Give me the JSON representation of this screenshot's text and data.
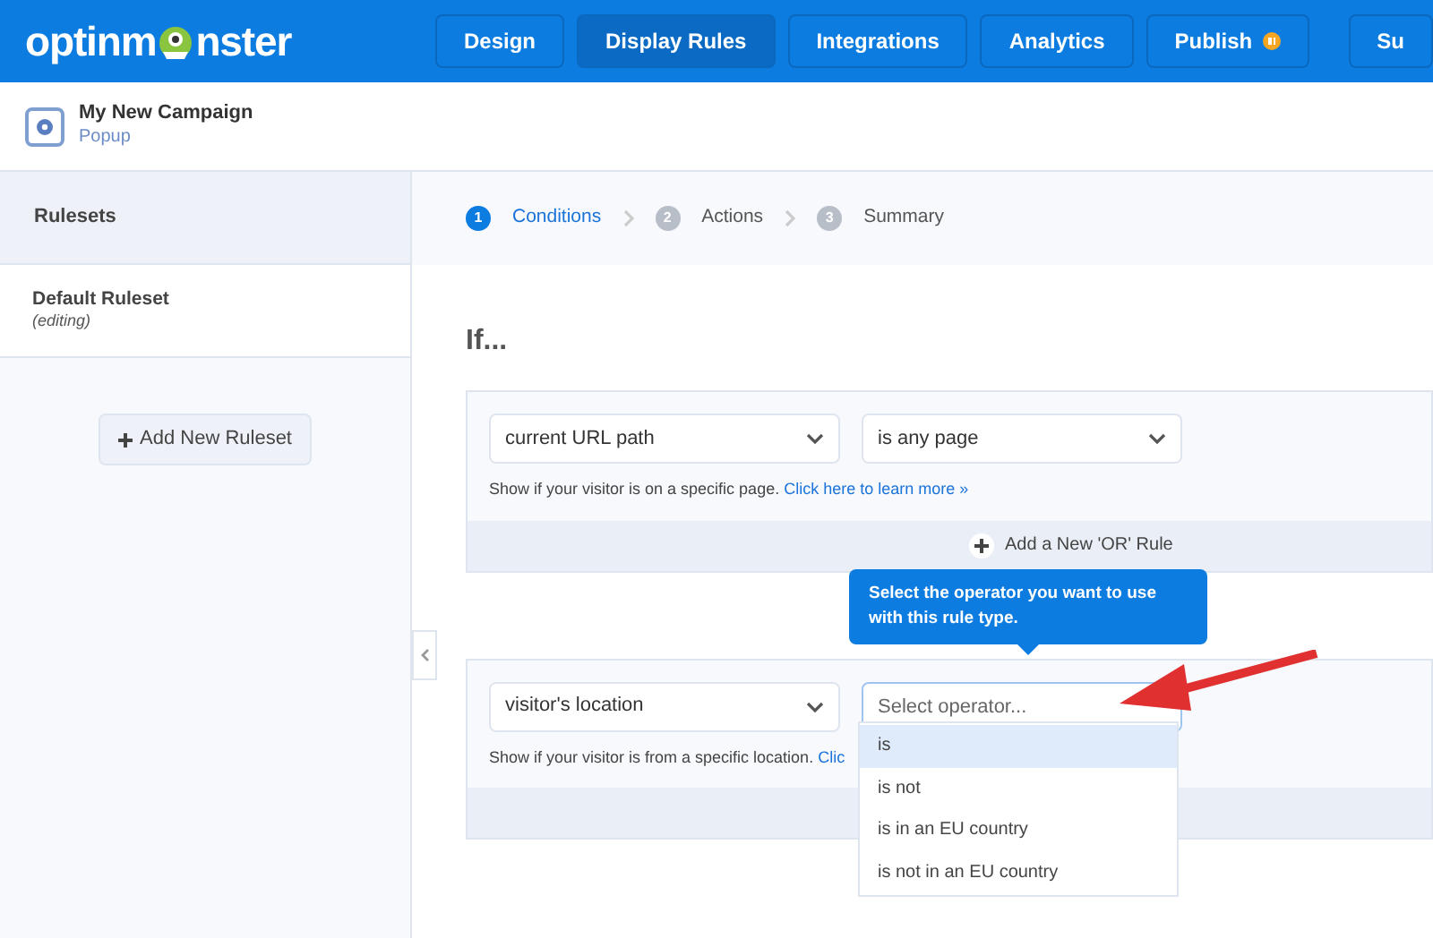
{
  "logo": {
    "before": "optinm",
    "after": "nster"
  },
  "nav": [
    {
      "label": "Design",
      "selected": false
    },
    {
      "label": "Display Rules",
      "selected": true
    },
    {
      "label": "Integrations",
      "selected": false
    },
    {
      "label": "Analytics",
      "selected": false
    },
    {
      "label": "Publish",
      "selected": false,
      "badge": true
    },
    {
      "label": "Su",
      "selected": false
    }
  ],
  "campaign": {
    "title": "My New Campaign",
    "type": "Popup"
  },
  "sidebar": {
    "title": "Rulesets",
    "rulesets": [
      {
        "name": "Default Ruleset",
        "status": "(editing)"
      }
    ],
    "add_button": "Add New Ruleset"
  },
  "steps": [
    {
      "number": "1",
      "label": "Conditions",
      "selected": true
    },
    {
      "number": "2",
      "label": "Actions",
      "selected": false
    },
    {
      "number": "3",
      "label": "Summary",
      "selected": false
    }
  ],
  "heading": "If...",
  "groups": [
    {
      "condition": "current URL path",
      "operator": {
        "value": "is any page"
      },
      "help": "Show if your visitor is on a specific page.",
      "link": "Click here to learn more »",
      "or_button": "Add a New 'OR' Rule"
    },
    {
      "condition": "visitor's location",
      "operator": {
        "placeholder": "Select operator..."
      },
      "help": "Show if your visitor is from a specific location.",
      "link": "Clic"
    }
  ],
  "tooltip": "Select the operator you want to use with this rule type.",
  "options": [
    {
      "label": "is",
      "selected": true
    },
    {
      "label": "is not",
      "selected": false
    },
    {
      "label": "is in an EU country",
      "selected": false
    },
    {
      "label": "is not in an EU country",
      "selected": false
    }
  ]
}
